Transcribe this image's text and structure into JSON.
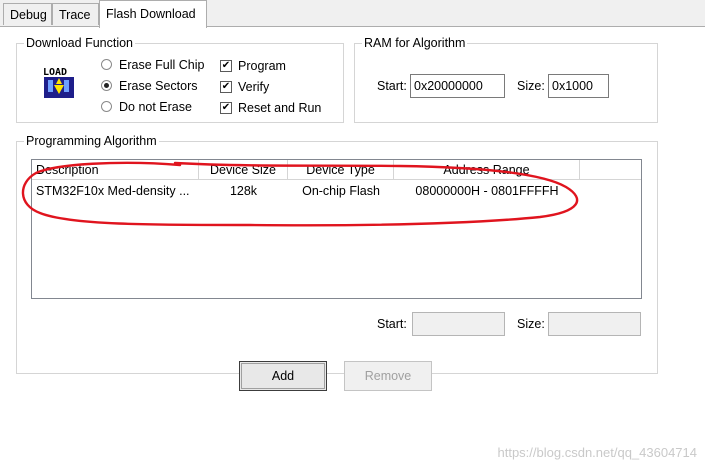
{
  "tabs": [
    {
      "label": "Debug",
      "active": false
    },
    {
      "label": "Trace",
      "active": false
    },
    {
      "label": "Flash Download",
      "active": true
    }
  ],
  "download_function": {
    "title": "Download Function",
    "icon": "load-icon",
    "icon_text": "LOAD",
    "erase_options": [
      {
        "label": "Erase Full Chip",
        "selected": false
      },
      {
        "label": "Erase Sectors",
        "selected": true
      },
      {
        "label": "Do not Erase",
        "selected": false
      }
    ],
    "checks": [
      {
        "label": "Program",
        "checked": true
      },
      {
        "label": "Verify",
        "checked": true
      },
      {
        "label": "Reset and Run",
        "checked": true
      }
    ]
  },
  "ram": {
    "title": "RAM for Algorithm",
    "start_label": "Start:",
    "start_value": "0x20000000",
    "size_label": "Size:",
    "size_value": "0x1000"
  },
  "programming": {
    "title": "Programming Algorithm",
    "columns": [
      "Description",
      "Device Size",
      "Device Type",
      "Address Range"
    ],
    "rows": [
      {
        "description": "STM32F10x Med-density ...",
        "size": "128k",
        "type": "On-chip Flash",
        "range": "08000000H - 0801FFFFH"
      }
    ],
    "start_label": "Start:",
    "start_value": "",
    "size_label": "Size:",
    "size_value": ""
  },
  "buttons": {
    "add": "Add",
    "remove": "Remove"
  },
  "watermark": "https://blog.csdn.net/qq_43604714",
  "colors": {
    "annotation": "#e0141e",
    "accent": "#000000"
  }
}
